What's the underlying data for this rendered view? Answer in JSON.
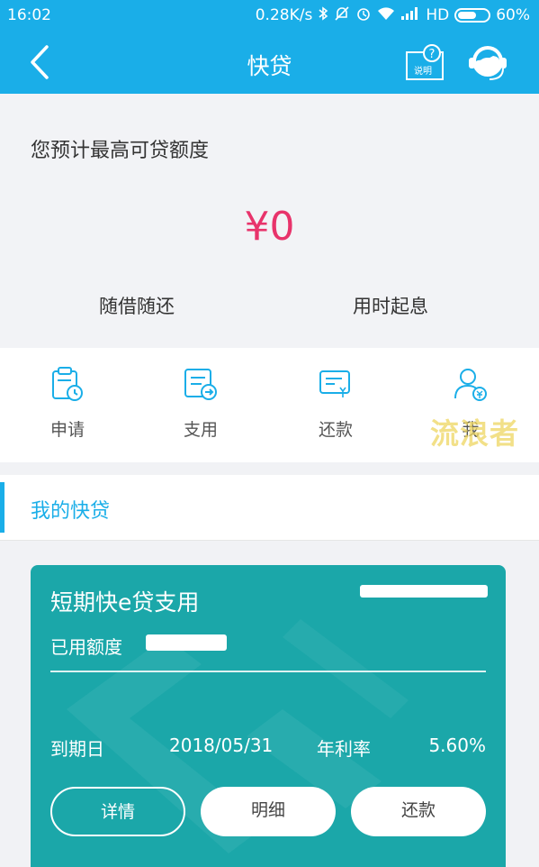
{
  "status_bar": {
    "time": "16:02",
    "network_speed": "0.28K/s",
    "network_type": "HD",
    "battery": "60%",
    "icons": [
      "bluetooth-icon",
      "mute-icon",
      "alarm-icon",
      "wifi-icon",
      "signal-icon",
      "battery-icon"
    ]
  },
  "nav": {
    "title": "快贷",
    "help_label": "说明",
    "help_mark": "?"
  },
  "summary": {
    "label": "您预计最高可贷额度",
    "amount": "¥0",
    "feature_left": "随借随还",
    "feature_right": "用时起息"
  },
  "actions": [
    {
      "label": "申请",
      "icon": "apply-icon"
    },
    {
      "label": "支用",
      "icon": "draw-icon"
    },
    {
      "label": "还款",
      "icon": "repay-icon"
    },
    {
      "label": "我",
      "icon": "account-icon"
    }
  ],
  "watermark": "流浪者",
  "section": {
    "title": "我的快贷"
  },
  "card": {
    "title": "短期快e贷支用",
    "used_label": "已用额度",
    "due_label": "到期日",
    "due_date": "2018/05/31",
    "rate_label": "年利率",
    "rate_value": "5.60%",
    "buttons": {
      "details": "详情",
      "detail_list": "明细",
      "repay": "还款"
    }
  },
  "colors": {
    "brand": "#1aaee8",
    "amount": "#e8336b",
    "card": "#1ba7a9"
  }
}
